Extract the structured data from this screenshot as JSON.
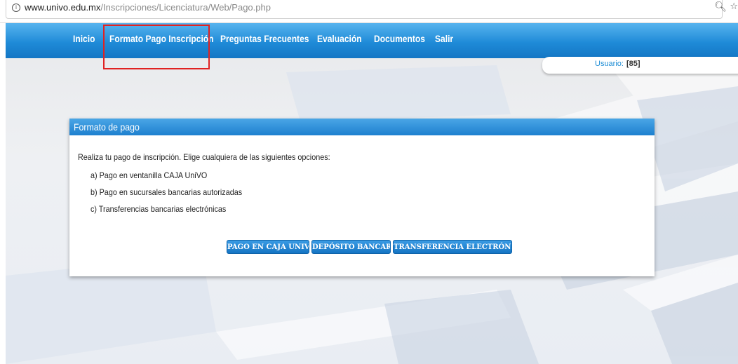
{
  "browser": {
    "url_domain": "www.univo.edu.mx",
    "url_path": "/Inscripciones/Licenciatura/Web/Pago.php",
    "info_icon": "info-circle-icon",
    "zoom_icon": "zoom-icon",
    "star_icon": "bookmark-star-icon"
  },
  "nav": {
    "items": [
      {
        "label": "Inicio"
      },
      {
        "label": "Formato Pago Inscripción"
      },
      {
        "label": "Preguntas Frecuentes"
      },
      {
        "label": "Evaluación"
      },
      {
        "label": "Documentos"
      },
      {
        "label": "Salir"
      }
    ],
    "highlight_color": "#e02222"
  },
  "user": {
    "label": "Usuario:",
    "value": "[85]"
  },
  "panel": {
    "title": "Formato de pago",
    "intro": "Realiza tu pago de inscripción. Elige cualquiera de las siguientes opciones:",
    "options": [
      "a) Pago en ventanilla CAJA UniVO",
      "b) Pago en sucursales bancarias autorizadas",
      "c) Transferencias bancarias electrónicas"
    ],
    "buttons": [
      {
        "label": "PAGO EN CAJA UNIVO"
      },
      {
        "label": "DEPÓSITO BANCARIO"
      },
      {
        "label": "TRANSFERENCIA ELECTRÓNICA"
      }
    ]
  },
  "colors": {
    "nav_blue": "#1f8bd8",
    "accent_blue": "#1a8bd4"
  }
}
